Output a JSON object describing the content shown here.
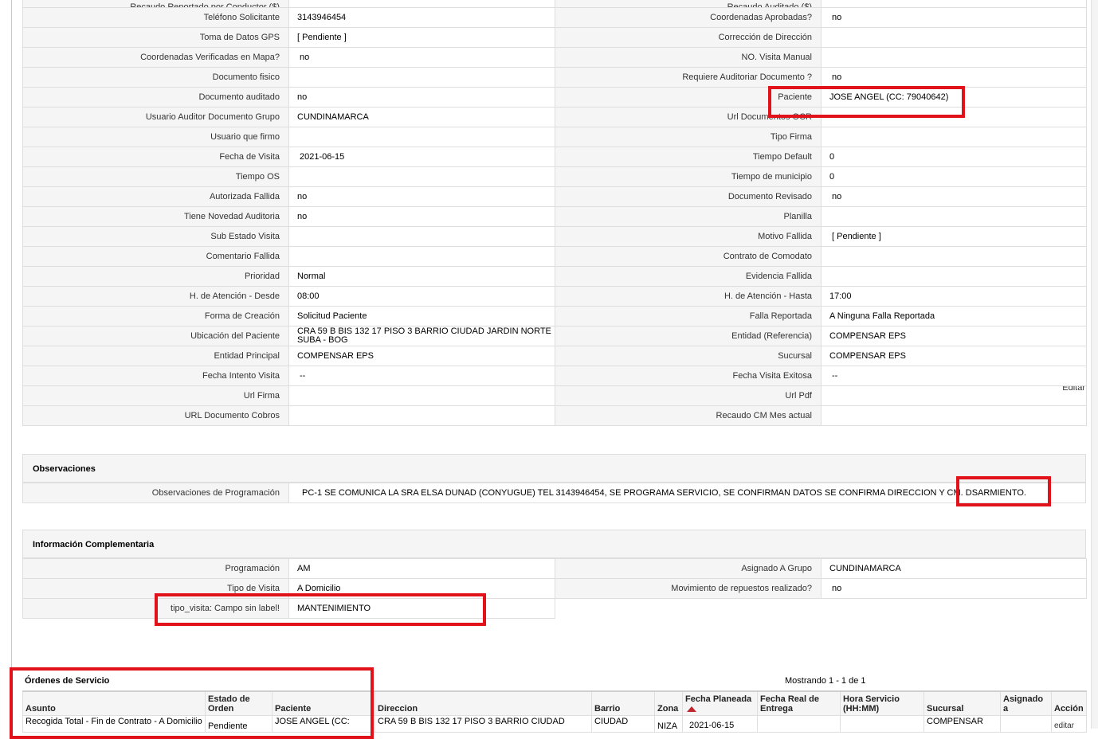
{
  "detail_rows": [
    {
      "l_label": "Recaudo Reportado por Conductor ($)",
      "l_value": "",
      "r_label": "Recaudo Auditado ($)",
      "r_value": ""
    },
    {
      "l_label": "Teléfono Solicitante",
      "l_value": "3143946454",
      "r_label": "Coordenadas Aprobadas?",
      "r_value": "no"
    },
    {
      "l_label": "Toma de Datos GPS",
      "l_value": "[ Pendiente ]",
      "r_label": "Corrección de Dirección",
      "r_value": ""
    },
    {
      "l_label": "Coordenadas Verificadas en Mapa?",
      "l_value": "no",
      "r_label": "NO. Visita Manual",
      "r_value": ""
    },
    {
      "l_label": "Documento fisico",
      "l_value": "",
      "r_label": "Requiere Auditoriar Documento ?",
      "r_value": "no"
    },
    {
      "l_label": "Documento auditado",
      "l_value": "no",
      "r_label": "Paciente",
      "r_value": "JOSE ANGEL (CC: 79040642)"
    },
    {
      "l_label": "Usuario Auditor Documento Grupo",
      "l_value": "CUNDINAMARCA",
      "r_label": "Url Documentos OCR",
      "r_value": ""
    },
    {
      "l_label": "Usuario que firmo",
      "l_value": "",
      "r_label": "Tipo Firma",
      "r_value": ""
    },
    {
      "l_label": "Fecha de Visita",
      "l_value": "2021-06-15",
      "r_label": "Tiempo Default",
      "r_value": "0"
    },
    {
      "l_label": "Tiempo OS",
      "l_value": "",
      "r_label": "Tiempo de municipio",
      "r_value": "0"
    },
    {
      "l_label": "Autorizada Fallida",
      "l_value": "no",
      "r_label": "Documento Revisado",
      "r_value": "no"
    },
    {
      "l_label": "Tiene Novedad Auditoria",
      "l_value": "no",
      "r_label": "Planilla",
      "r_value": ""
    },
    {
      "l_label": "Sub Estado Visita",
      "l_value": "",
      "r_label": "Motivo Fallida",
      "r_value": "[ Pendiente ]"
    },
    {
      "l_label": "Comentario Fallida",
      "l_value": "",
      "r_label": "Contrato de Comodato",
      "r_value": ""
    },
    {
      "l_label": "Prioridad",
      "l_value": "Normal",
      "r_label": "Evidencia Fallida",
      "r_value": ""
    },
    {
      "l_label": "H. de Atención - Desde",
      "l_value": "08:00",
      "r_label": "H. de Atención - Hasta",
      "r_value": "17:00"
    },
    {
      "l_label": "Forma de Creación",
      "l_value": "Solicitud Paciente",
      "r_label": "Falla Reportada",
      "r_value": "A Ninguna Falla Reportada"
    },
    {
      "l_label": "Ubicación del Paciente",
      "l_value": "CRA 59 B BIS 132 17 PISO 3 BARRIO CIUDAD JARDIN NORTE SUBA - BOG",
      "r_label": "Entidad (Referencia)",
      "r_value": "COMPENSAR EPS"
    },
    {
      "l_label": "Entidad Principal",
      "l_value": "COMPENSAR EPS",
      "r_label": "Sucursal",
      "r_value": "COMPENSAR EPS"
    },
    {
      "l_label": "Fecha Intento Visita",
      "l_value": "--",
      "r_label": "Fecha Visita Exitosa",
      "r_value": "--"
    },
    {
      "l_label": "Url Firma",
      "l_value": "",
      "r_label": "Url Pdf",
      "r_value": ""
    },
    {
      "l_label": "URL Documento Cobros",
      "l_value": "",
      "r_label": "Recaudo CM Mes actual",
      "r_value": ""
    }
  ],
  "edit_link": "Editar",
  "observaciones": {
    "title": "Observaciones",
    "label": "Observaciones de Programación",
    "value": "PC-1 SE COMUNICA LA SRA ELSA DUNAD (CONYUGUE) TEL 3143946454, SE PROGRAMA SERVICIO, SE CONFIRMAN DATOS SE CONFIRMA DIRECCION Y CM. DSARMIENTO."
  },
  "complementaria": {
    "title": "Información Complementaria",
    "rows": [
      {
        "l_label": "Programación",
        "l_value": "AM",
        "r_label": "Asignado A Grupo",
        "r_value": "CUNDINAMARCA"
      },
      {
        "l_label": "Tipo de Visita",
        "l_value": "A Domicilio",
        "r_label": "Movimiento de repuestos realizado?",
        "r_value": "no"
      },
      {
        "l_label": "tipo_visita: Campo sin label!",
        "l_value": "MANTENIMIENTO",
        "r_label": "",
        "r_value": ""
      }
    ]
  },
  "orders": {
    "title": "Órdenes de Servicio",
    "count_text": "Mostrando 1 - 1 de 1",
    "headers": [
      "Asunto",
      "Estado de Orden",
      "Paciente",
      "Direccion",
      "Barrio",
      "Zona",
      "Fecha Planeada",
      "Fecha Real de Entrega",
      "Hora Servicio (HH:MM)",
      "Sucursal",
      "Asignado a",
      "Acción"
    ],
    "rows": [
      [
        "Recogida Total - Fin de Contrato - A Domicilio",
        "Pendiente",
        "JOSE ANGEL (CC:",
        "CRA 59 B BIS 132 17 PISO 3 BARRIO CIUDAD",
        "CIUDAD",
        "NIZA",
        "2021-06-15",
        "",
        "",
        "COMPENSAR",
        "",
        "editar"
      ]
    ]
  }
}
